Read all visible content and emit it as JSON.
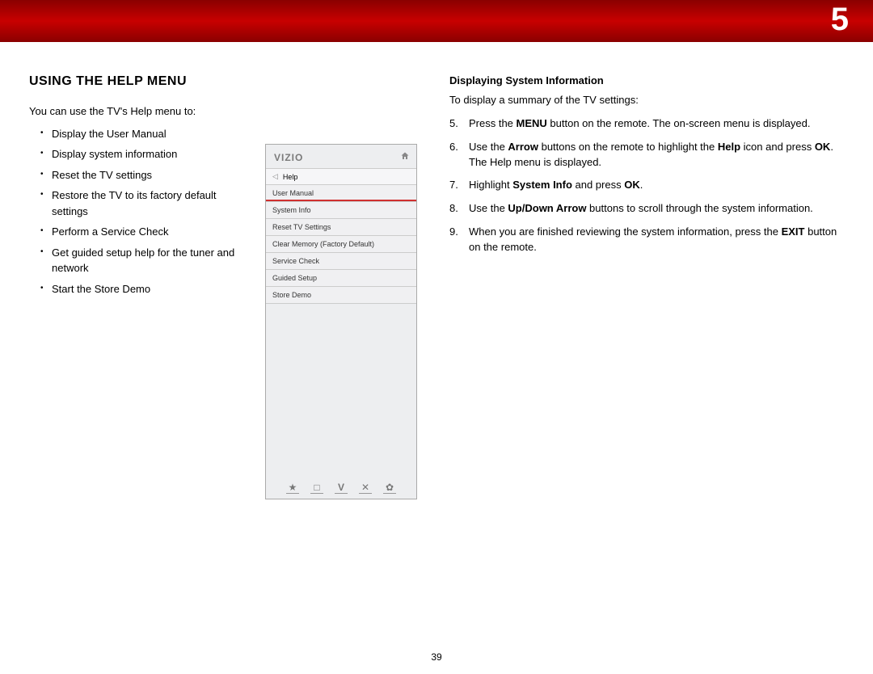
{
  "chapter_number": "5",
  "page_number": "39",
  "left": {
    "title": "USING THE HELP MENU",
    "intro": "You can use the TV's Help menu to:",
    "bullets": [
      "Display the User Manual",
      "Display system information",
      "Reset the TV settings",
      "Restore the TV to its factory default settings",
      "Perform a Service Check",
      "Get guided setup help for the tuner and network",
      "Start the Store Demo"
    ]
  },
  "tv_menu": {
    "logo": "VIZIO",
    "home_icon": "home-icon",
    "title": "Help",
    "items": [
      "User Manual",
      "System Info",
      "Reset TV Settings",
      "Clear Memory (Factory Default)",
      "Service Check",
      "Guided Setup",
      "Store Demo"
    ],
    "footer_icons": [
      "star-icon",
      "caption-icon",
      "v-icon",
      "close-icon",
      "gear-icon"
    ]
  },
  "right": {
    "subhead": "Displaying System Information",
    "intro": "To display a summary of the TV settings:",
    "steps": [
      {
        "n": "5.",
        "plain_before": "Press the ",
        "bold1": "MENU",
        "plain_mid": " button on the remote. The on-screen menu is displayed.",
        "bold2": "",
        "plain_after": ""
      },
      {
        "n": "6.",
        "plain_before": "Use the ",
        "bold1": "Arrow",
        "plain_mid": " buttons on the remote to highlight the ",
        "bold2": "Help",
        "plain_after": " icon and press ",
        "bold3": "OK",
        "tail": ". The Help menu is displayed."
      },
      {
        "n": "7.",
        "plain_before": "Highlight ",
        "bold1": "System Info",
        "plain_mid": " and press ",
        "bold2": "OK",
        "plain_after": "."
      },
      {
        "n": "8.",
        "plain_before": "Use the ",
        "bold1": "Up/Down Arrow",
        "plain_mid": " buttons to scroll through the system information.",
        "bold2": "",
        "plain_after": ""
      },
      {
        "n": "9.",
        "plain_before": "When you are finished reviewing the system information, press the ",
        "bold1": "EXIT",
        "plain_mid": " button on the remote.",
        "bold2": "",
        "plain_after": ""
      }
    ]
  }
}
